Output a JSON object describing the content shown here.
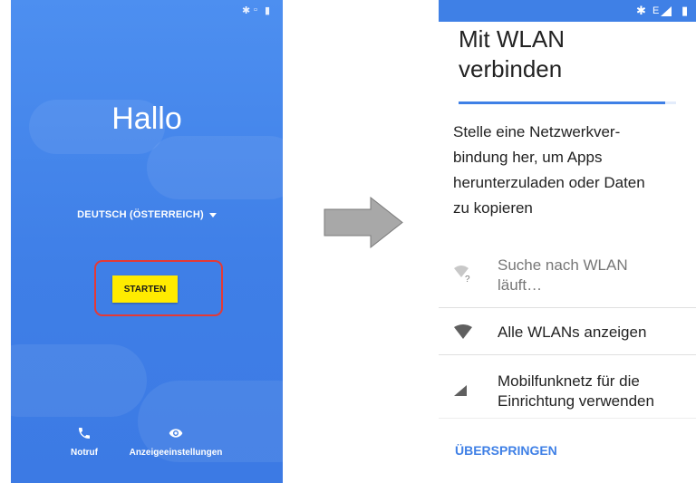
{
  "welcome": {
    "title": "Hallo",
    "language": "DEUTSCH (ÖSTERREICH)",
    "start_label": "STARTEN",
    "emergency_label": "Notruf",
    "display_label": "Anzeigeeinstellungen"
  },
  "wifi": {
    "title_line1": "Mit WLAN",
    "title_line2": "verbinden",
    "progress": 0.95,
    "intro": "Stelle eine Netzwerkverbindung her, um Apps herunterzuladen oder Daten zu kopieren",
    "intro_lines": [
      "Stelle eine Netzwerkver-",
      "bindung her, um Apps",
      "herunterzuladen oder Daten",
      "zu kopieren"
    ],
    "items": [
      {
        "line1": "Suche nach WLAN",
        "line2": "läuft…",
        "icon": "wifi-searching-icon"
      },
      {
        "line1": "Alle WLANs anzeigen",
        "line2": "",
        "icon": "wifi-icon"
      },
      {
        "line1": "Mobilfunknetz für die",
        "line2": "Einrichtung verwenden",
        "icon": "cell-signal-icon"
      }
    ],
    "skip_label": "ÜBERSPRINGEN"
  },
  "colors": {
    "welcome_bg": "#3f7fe7",
    "start_button": "#ffeb00",
    "highlight": "#e53935",
    "accent": "#3f80e6",
    "arrow": "#a8a8a8"
  }
}
